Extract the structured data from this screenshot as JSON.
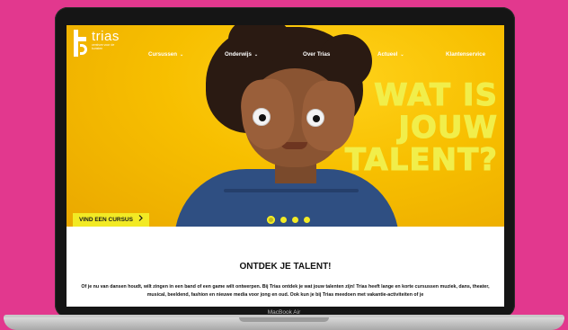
{
  "device": {
    "model_label": "MacBook Air"
  },
  "site": {
    "logo": {
      "word": "trias",
      "tagline": "centrum voor de kunsten"
    },
    "nav": [
      {
        "label": "Cursussen",
        "dropdown": true
      },
      {
        "label": "Onderwijs",
        "dropdown": true
      },
      {
        "label": "Over Trias",
        "dropdown": false
      },
      {
        "label": "Actueel",
        "dropdown": true
      },
      {
        "label": "Klantenservice",
        "dropdown": false
      }
    ],
    "hero": {
      "headline_line1": "WAT IS JOUW",
      "headline_line2": "TALENT?",
      "cta_label": "VIND EEN CURSUS",
      "cta_icon": "chevron-right-icon",
      "slides": 4,
      "active_slide": 1,
      "colors": {
        "background": "#f5bd00",
        "headline": "#f1ee4a",
        "cta": "#f2ea24"
      }
    },
    "content": {
      "title": "ONTDEK JE TALENT!",
      "body": "Of je nu van dansen houdt, wilt zingen in een band of een game wilt ontwerpen. Bij Trias ontdek je wat jouw talenten zijn! Trias heeft lange en korte cursussen muziek, dans, theater, musical, beeldend, fashion en nieuwe media voor jong en oud. Ook kun je bij Trias meedoen met vakantie-activiteiten of je"
    }
  },
  "colors": {
    "page_background": "#e2388e",
    "laptop_bezel": "#151515"
  }
}
